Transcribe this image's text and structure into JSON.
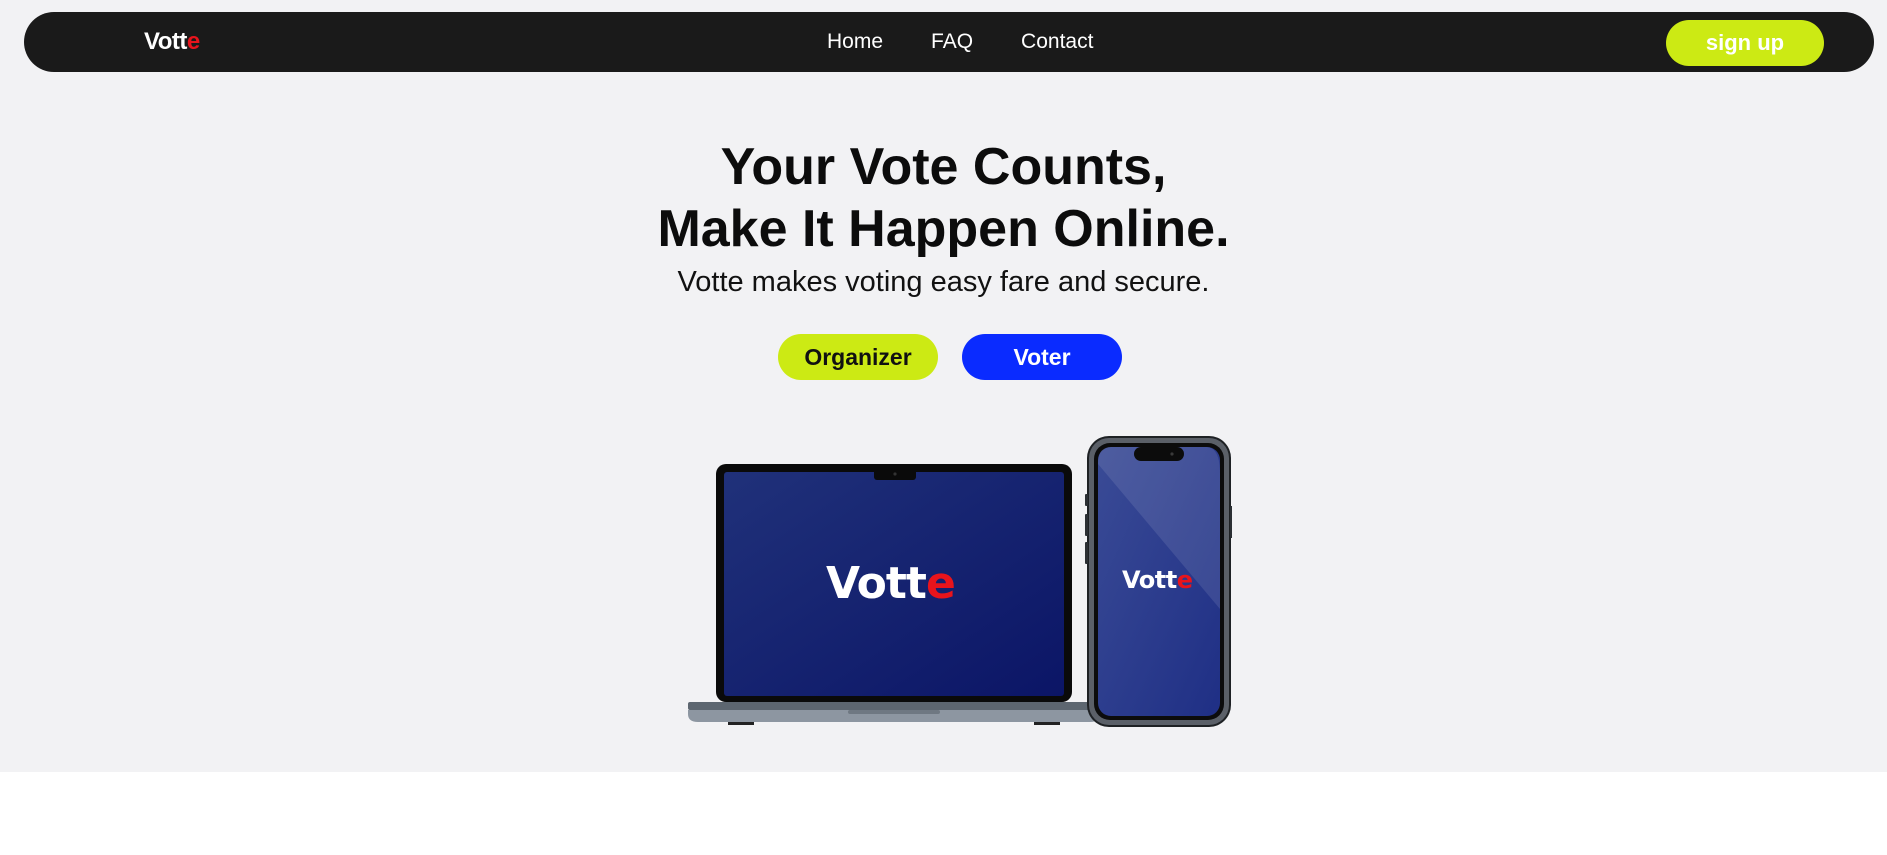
{
  "brand": {
    "name_main": "Vott",
    "name_accent": "e"
  },
  "nav": {
    "links": [
      "Home",
      "FAQ",
      "Contact"
    ],
    "signup_label": "sign up"
  },
  "hero": {
    "headline_line1": "Your Vote Counts,",
    "headline_line2": "Make It Happen Online.",
    "subtitle": "Votte makes voting easy fare and secure.",
    "organizer_label": "Organizer",
    "voter_label": "Voter"
  },
  "colors": {
    "navbar_bg": "#1a1a1a",
    "accent_lime": "#ccea14",
    "accent_blue": "#0a2bff",
    "brand_red": "#e8141c",
    "hero_bg": "#f2f2f4"
  },
  "icons": [
    "laptop-mockup",
    "phone-mockup"
  ]
}
